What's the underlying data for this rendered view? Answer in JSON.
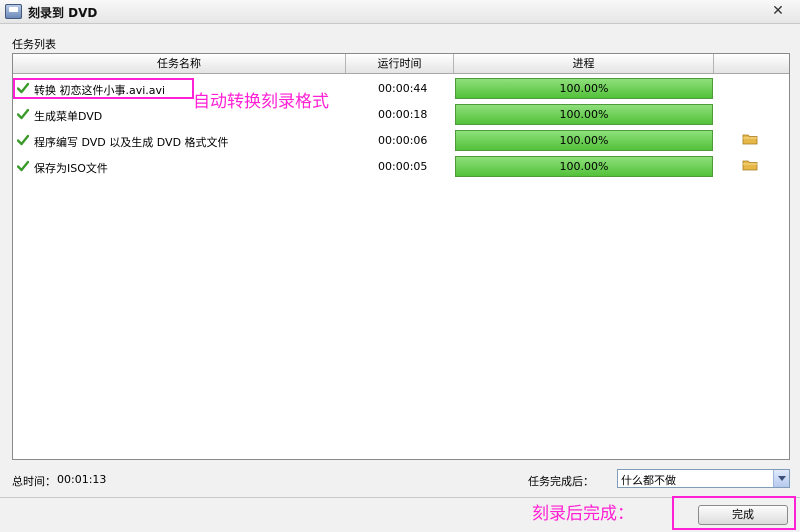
{
  "window": {
    "title": "刻录到 DVD",
    "close_glyph": "✕"
  },
  "section_label": "任务列表",
  "table": {
    "columns": [
      "任务名称",
      "运行时间",
      "进程",
      ""
    ],
    "rows": [
      {
        "name": "转换 初恋这件小事.avi.avi",
        "time": "00:00:44",
        "progress": 100,
        "progress_label": "100.00%",
        "has_folder": false
      },
      {
        "name": "生成菜单DVD",
        "time": "00:00:18",
        "progress": 100,
        "progress_label": "100.00%",
        "has_folder": false
      },
      {
        "name": "程序编写 DVD 以及生成 DVD 格式文件",
        "time": "00:00:06",
        "progress": 100,
        "progress_label": "100.00%",
        "has_folder": true
      },
      {
        "name": "保存为ISO文件",
        "time": "00:00:05",
        "progress": 100,
        "progress_label": "100.00%",
        "has_folder": true
      }
    ]
  },
  "footer": {
    "total_label": "总时间：",
    "total_value": "00:01:13",
    "after_label": "任务完成后：",
    "after_value": "什么都不做",
    "done_label": "完成"
  },
  "annotations": {
    "convert_note": "自动转换刻录格式",
    "done_note": "刻录后完成："
  },
  "colors": {
    "progress_fill": "#53c13a",
    "annotation": "#ff1fd4",
    "check": "#3a9a2a",
    "folder": "#e6b84a"
  },
  "icons": {
    "status": "checkmark-icon",
    "open": "folder-icon",
    "app": "dvd-burn-icon"
  }
}
